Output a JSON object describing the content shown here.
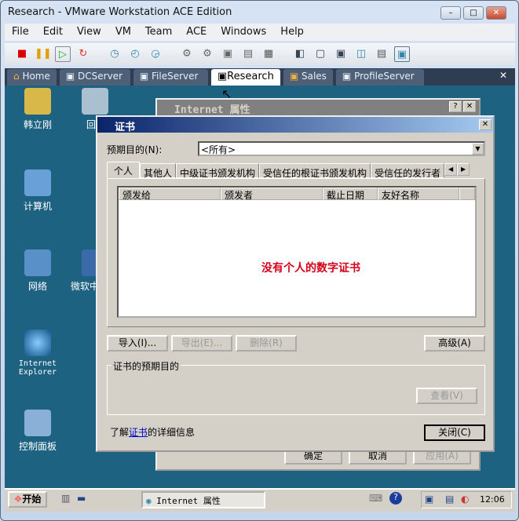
{
  "window": {
    "title": "Research - VMware Workstation ACE Edition",
    "min": "–",
    "max": "□",
    "close": "✕"
  },
  "menu": [
    "File",
    "Edit",
    "View",
    "VM",
    "Team",
    "ACE",
    "Windows",
    "Help"
  ],
  "tabs": [
    {
      "label": "Home"
    },
    {
      "label": "DCServer"
    },
    {
      "label": "FileServer"
    },
    {
      "label": "Research",
      "active": true
    },
    {
      "label": "Sales"
    },
    {
      "label": "ProfileServer"
    }
  ],
  "tabs_close": "✕",
  "desktop_icons": [
    "韩立刚",
    "回",
    "计算机",
    "网络",
    "微软中",
    "Internet Explorer",
    "控制面板"
  ],
  "bg_dialog": {
    "title": "Internet 属性",
    "help": "?",
    "close": "✕",
    "ok": "确定",
    "cancel": "取消",
    "apply": "应用(A)"
  },
  "cert_dialog": {
    "title": "证书",
    "close": "✕",
    "purpose_label": "预期目的(N):",
    "purpose_value": "<所有>",
    "tabs": [
      "个人",
      "其他人",
      "中级证书颁发机构",
      "受信任的根证书颁发机构",
      "受信任的发行者"
    ],
    "columns": [
      "颁发给",
      "颁发者",
      "截止日期",
      "友好名称"
    ],
    "empty_message": "没有个人的数字证书",
    "import": "导入(I)...",
    "export": "导出(E)...",
    "remove": "删除(R)",
    "advanced": "高级(A)",
    "group_label": "证书的预期目的",
    "view": "查看(V)",
    "learn_prefix": "了解",
    "learn_link": "证书",
    "learn_suffix": "的详细信息",
    "close_btn": "关闭(C)"
  },
  "taskbar": {
    "start": "开始",
    "task": "Internet 属性",
    "clock": "12:06"
  },
  "colors": {
    "desktop": "#1e6282",
    "cert_title": "#0a246a",
    "empty_text": "#d4001a"
  }
}
